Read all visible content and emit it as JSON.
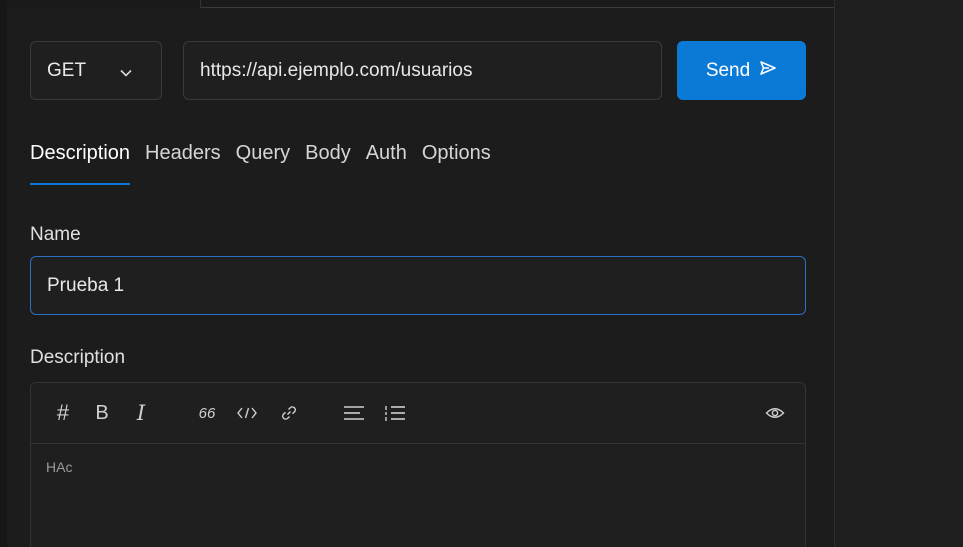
{
  "request": {
    "method": "GET",
    "url": "https://api.ejemplo.com/usuarios",
    "send_label": "Send"
  },
  "tabs": [
    {
      "label": "Description",
      "active": true
    },
    {
      "label": "Headers",
      "active": false
    },
    {
      "label": "Query",
      "active": false
    },
    {
      "label": "Body",
      "active": false
    },
    {
      "label": "Auth",
      "active": false
    },
    {
      "label": "Options",
      "active": false
    }
  ],
  "name_section": {
    "label": "Name",
    "value": "Prueba 1"
  },
  "description_section": {
    "label": "Description",
    "toolbar": {
      "heading_glyph": "#",
      "bold_glyph": "B",
      "italic_glyph": "I",
      "quote_glyph": "66",
      "tools": [
        "heading-icon",
        "bold-icon",
        "italic-icon",
        "quote-icon",
        "code-icon",
        "link-icon",
        "bullet-list-icon",
        "numbered-list-icon",
        "preview-eye-icon"
      ]
    },
    "content": "HAc"
  },
  "colors": {
    "accent": "#0b7ad6",
    "background": "#1c1c1c",
    "focus_border": "#2c6fc4"
  }
}
